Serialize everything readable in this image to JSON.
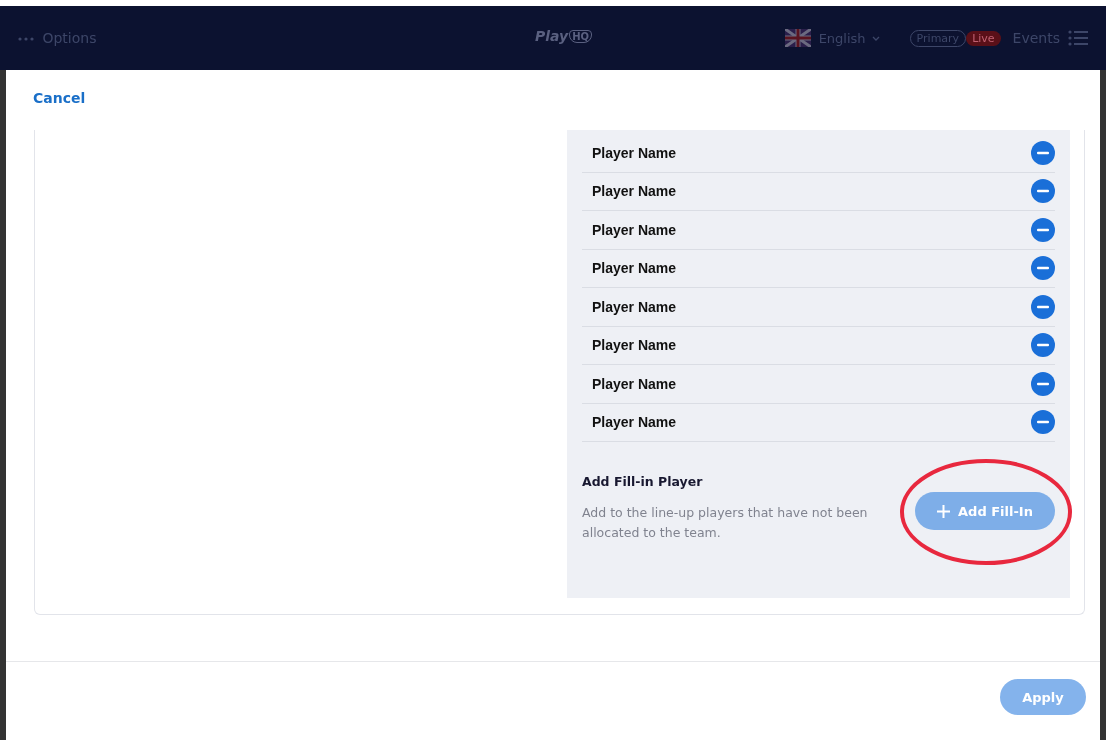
{
  "header": {
    "options": "Options",
    "logo": {
      "text": "Play",
      "mark": "HQ"
    },
    "language": "English",
    "badges": [
      {
        "label": "Primary",
        "kind": "outline"
      },
      {
        "label": "Live",
        "kind": "live"
      }
    ],
    "events": "Events"
  },
  "modal": {
    "cancel": "Cancel",
    "players": [
      {
        "name": "Player Name"
      },
      {
        "name": "Player Name"
      },
      {
        "name": "Player Name"
      },
      {
        "name": "Player Name"
      },
      {
        "name": "Player Name"
      },
      {
        "name": "Player Name"
      },
      {
        "name": "Player Name"
      },
      {
        "name": "Player Name"
      }
    ],
    "fill_in": {
      "title": "Add Fill-in Player",
      "description": "Add to the line-up players that have not been allocated to the team.",
      "button": {
        "label": "Add Fill-In",
        "disabled": true
      }
    },
    "apply": {
      "label": "Apply",
      "disabled": true
    }
  }
}
